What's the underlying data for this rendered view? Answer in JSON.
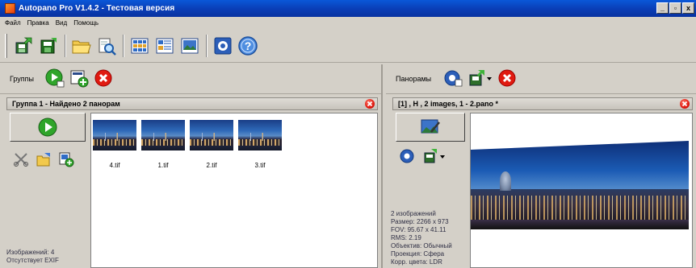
{
  "window": {
    "title": "Autopano Pro V1.4.2 - Тестовая версия",
    "btn_min": "_",
    "btn_max": "▫",
    "btn_close": "x"
  },
  "menu": {
    "items": [
      "Файл",
      "Правка",
      "Вид",
      "Помощь"
    ]
  },
  "colors": {
    "accent": "#0a3fb8",
    "close_red": "#e01a10",
    "play_green": "#2fa52a"
  },
  "groups_panel": {
    "label": "Группы"
  },
  "panoramas_panel": {
    "label": "Панорамы"
  },
  "group": {
    "header": "Группа 1 - Найдено 2 панорам",
    "thumbnails": [
      {
        "name": "4.tif"
      },
      {
        "name": "1.tif"
      },
      {
        "name": "2.tif"
      },
      {
        "name": "3.tif"
      }
    ],
    "info": [
      "Изображений: 4",
      "Отсутствует EXIF"
    ]
  },
  "pano": {
    "header": "[1] , H , 2 images, 1 - 2.pano *",
    "info": [
      "2 изображений",
      "Размер: 2266 x 973",
      "FOV: 95.67 x 41.11",
      "RMS: 2.19",
      "Объектив: Обычный",
      "Проекция: Сфера",
      "Корр. цвета: LDR"
    ]
  }
}
